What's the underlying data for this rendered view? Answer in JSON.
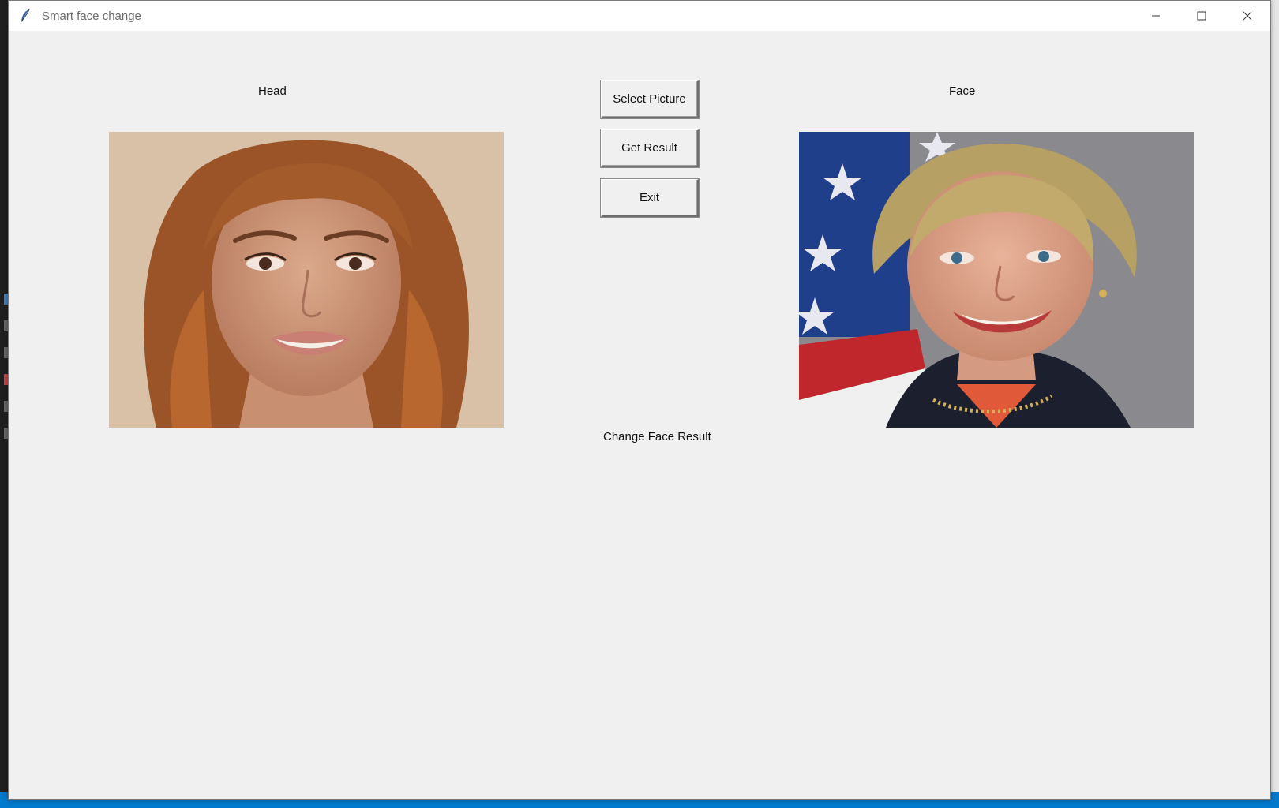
{
  "window": {
    "title": "Smart face change",
    "controls": {
      "minimize": "–",
      "maximize": "□",
      "close": "✕"
    }
  },
  "labels": {
    "head": "Head",
    "face": "Face",
    "result": "Change Face Result"
  },
  "buttons": {
    "select": "Select Picture",
    "get_result": "Get Result",
    "exit": "Exit"
  },
  "colors": {
    "window_bg": "#f0f0f0",
    "titlebar_bg": "#ffffff",
    "status_bar": "#007acc"
  }
}
